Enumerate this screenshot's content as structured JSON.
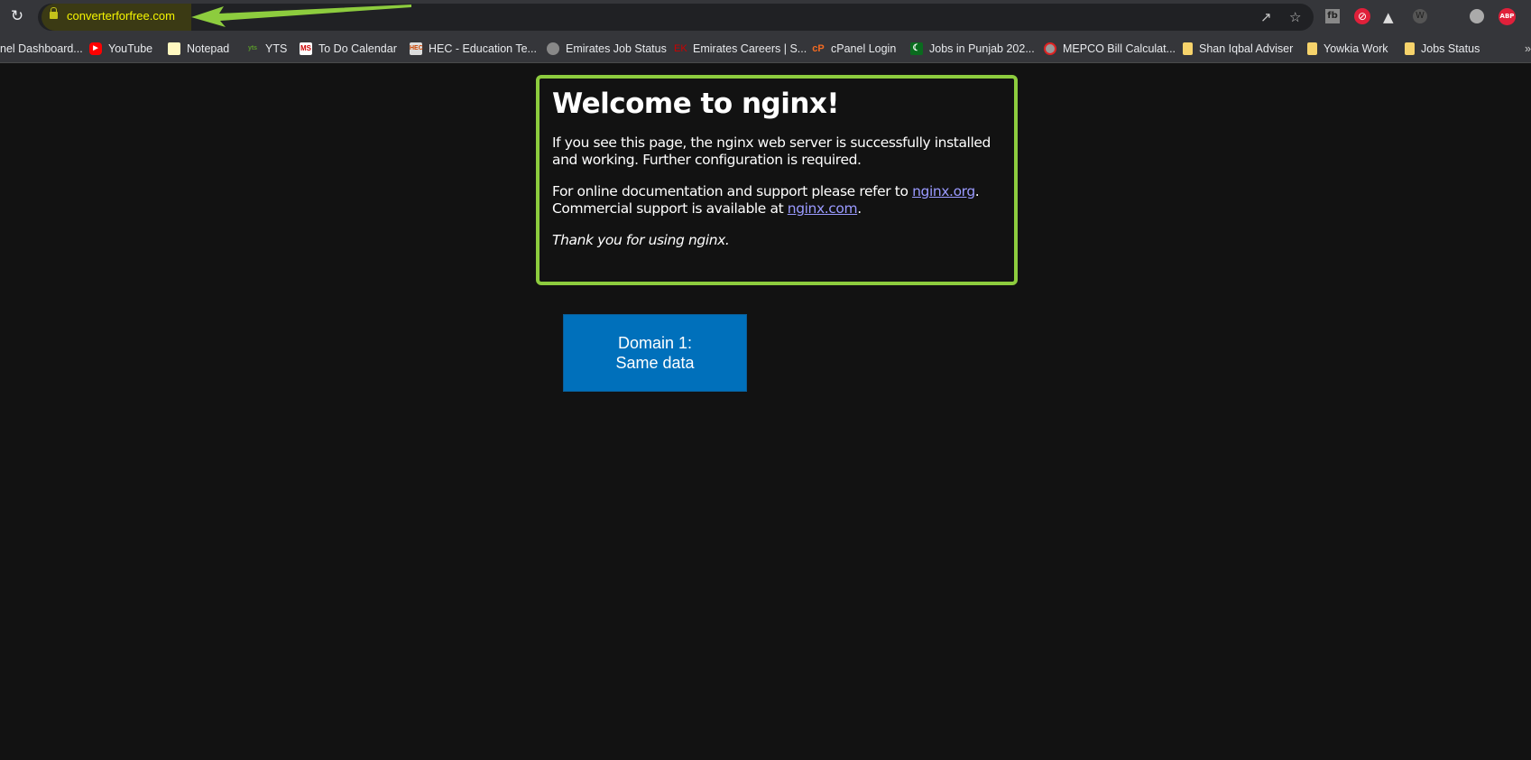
{
  "browser": {
    "url": "converterforfree.com",
    "bookmarks": [
      {
        "label": "nel Dashboard...",
        "icon": "none"
      },
      {
        "label": "YouTube",
        "icon": "youtube-icon"
      },
      {
        "label": "Notepad",
        "icon": "notepad-icon"
      },
      {
        "label": "YTS",
        "icon": "yts-icon"
      },
      {
        "label": "To Do Calendar",
        "icon": "calendar-icon"
      },
      {
        "label": "HEC - Education Te...",
        "icon": "hec-icon"
      },
      {
        "label": "Emirates Job Status",
        "icon": "globe-icon"
      },
      {
        "label": "Emirates Careers | S...",
        "icon": "ek-icon"
      },
      {
        "label": "cPanel Login",
        "icon": "cpanel-icon"
      },
      {
        "label": "Jobs in Punjab 202...",
        "icon": "pakistan-flag-icon"
      },
      {
        "label": "MEPCO Bill Calculat...",
        "icon": "mepco-icon"
      },
      {
        "label": "Shan Iqbal Adviser",
        "icon": "folder-icon"
      },
      {
        "label": "Yowkia Work",
        "icon": "folder-icon"
      },
      {
        "label": "Jobs Status",
        "icon": "folder-icon"
      }
    ],
    "extensions": [
      "share-icon",
      "star-icon",
      "extension-tb-icon",
      "extension-opera-icon",
      "extension-triangle-icon",
      "wordpress-icon",
      "globe-icon",
      "adblock-plus-icon"
    ],
    "abp_label": "ABP",
    "accent": "#8dcc3e"
  },
  "page": {
    "title": "Welcome to nginx!",
    "p1": "If you see this page, the nginx web server is successfully installed and working. Further configuration is required.",
    "p2_pre": "For online documentation and support please refer to ",
    "link1": "nginx.org",
    "p2_mid": ".",
    "p2_line2": "Commercial support is available at ",
    "link2": "nginx.com",
    "p2_end": ".",
    "thanks": "Thank you for using nginx."
  },
  "annotation": {
    "line1": "Domain 1:",
    "line2": "Same data",
    "color": "#0070bb"
  }
}
